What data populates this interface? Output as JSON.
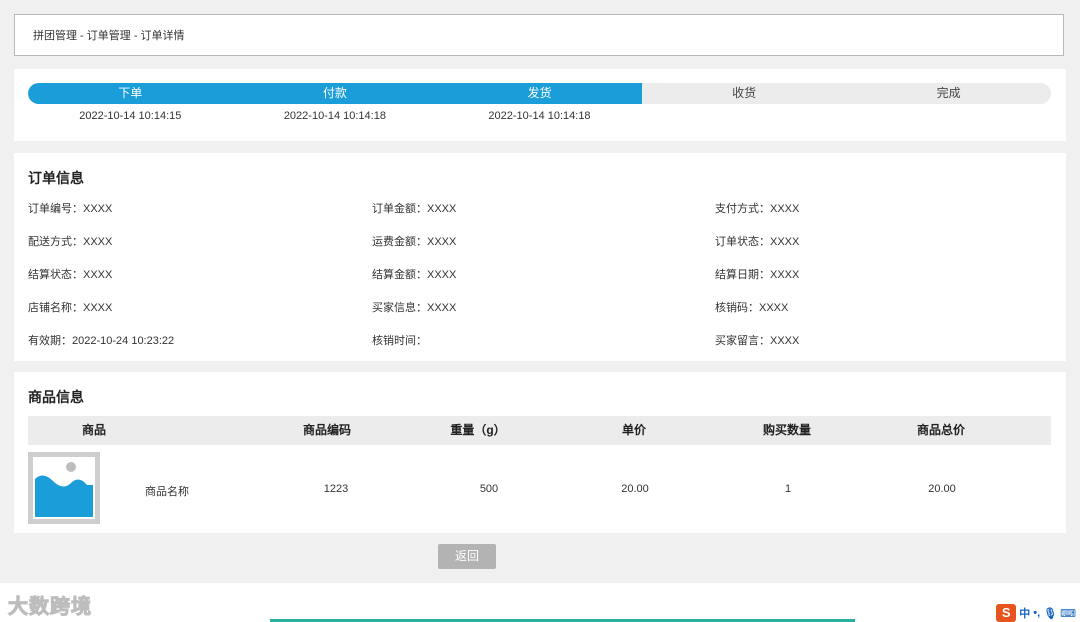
{
  "breadcrumb": "拼团管理 - 订单管理 - 订单详情",
  "progress": {
    "completed_fraction": 0.6,
    "steps": [
      {
        "label": "下单",
        "time": "2022-10-14 10:14:15"
      },
      {
        "label": "付款",
        "time": "2022-10-14 10:14:18"
      },
      {
        "label": "发货",
        "time": "2022-10-14 10:14:18"
      },
      {
        "label": "收货",
        "time": ""
      },
      {
        "label": "完成",
        "time": ""
      }
    ]
  },
  "order_info": {
    "title": "订单信息",
    "fields": [
      "订单编号：XXXX",
      "订单金额：XXXX",
      "支付方式：XXXX",
      "配送方式：XXXX",
      "运费金额：XXXX",
      "订单状态：XXXX",
      "结算状态：XXXX",
      "结算金额：XXXX",
      "结算日期：XXXX",
      "店铺名称：XXXX",
      "买家信息：XXXX",
      "核销码：XXXX",
      "有效期：2022-10-24 10:23:22",
      "核销时间：",
      "买家留言：XXXX"
    ]
  },
  "goods_info": {
    "title": "商品信息",
    "columns": [
      "商品",
      "商品编码",
      "重量（g）",
      "单价",
      "购买数量",
      "商品总价"
    ],
    "rows": [
      {
        "name": "商品名称",
        "code": "1223",
        "weight": "500",
        "price": "20.00",
        "quantity": "1",
        "total": "20.00"
      }
    ]
  },
  "back_label": "返回",
  "watermark": "大数跨境",
  "ime": {
    "logo": "S",
    "mode": "中",
    "punct": "•,",
    "mic": "🎙",
    "keyboard": "⌨"
  },
  "colors": {
    "accent": "#1b9dd9",
    "button": "#b3b3b3"
  }
}
